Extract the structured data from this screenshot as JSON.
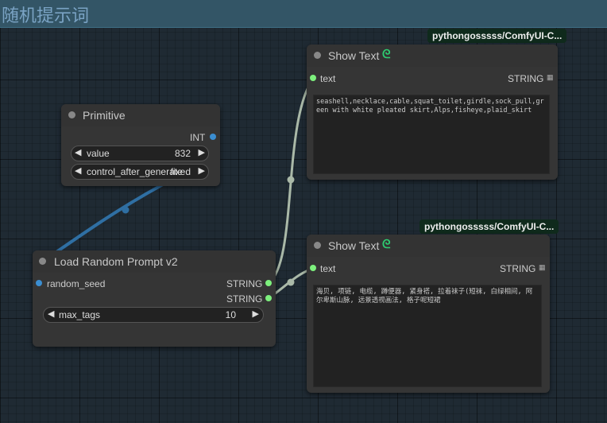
{
  "group": {
    "title": "随机提示词"
  },
  "colors": {
    "link_string": "#aab9a8",
    "link_int": "#2f6fa3",
    "slot_green": "#7df07d",
    "slot_blue": "#3b8ed1"
  },
  "primitive": {
    "title": "Primitive",
    "output_label": "INT",
    "widgets": [
      {
        "name": "value",
        "value": "832"
      },
      {
        "name": "control_after_generate",
        "value": "fixed"
      }
    ]
  },
  "load_prompt": {
    "title": "Load Random Prompt v2",
    "input_label": "random_seed",
    "outputs": [
      "STRING",
      "STRING"
    ],
    "widget": {
      "name": "max_tags",
      "value": "10"
    }
  },
  "show_text_1": {
    "badge": "pythongosssss/ComfyUI-C...",
    "title": "Show Text",
    "icon": "link-icon",
    "input_label": "text",
    "output_label": "STRING",
    "text": "seashell,necklace,cable,squat_toilet,girdle,sock_pull,green with white pleated skirt,Alps,fisheye,plaid_skirt"
  },
  "show_text_2": {
    "badge": "pythongosssss/ComfyUI-C...",
    "title": "Show Text",
    "icon": "link-icon",
    "input_label": "text",
    "output_label": "STRING",
    "text": "海贝, 项链, 电缆, 蹲便器, 紧身褡, 拉着袜子(短袜, 白绿相间, 阿尔卑斯山脉, 远景透视画法, 格子呢短裙"
  }
}
